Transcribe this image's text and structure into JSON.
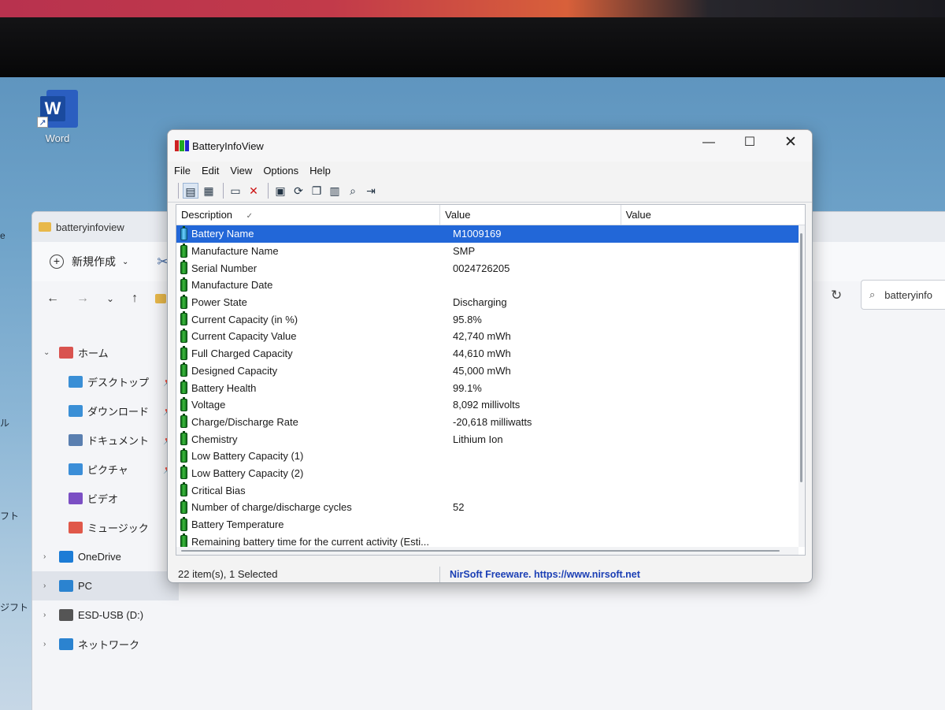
{
  "desktop": {
    "word_icon": {
      "glyph": "W",
      "label": "Word"
    },
    "left_fragments": [
      "e",
      "ル",
      "フト",
      "ジフト"
    ]
  },
  "explorer": {
    "title": "batteryinfoview",
    "new_label": "新規作成",
    "search_text": "batteryinfo",
    "nav": [
      {
        "label": "ホーム",
        "icon": "home-icon",
        "color": "#d9534f",
        "pinned": false,
        "expander": "⌄",
        "indent": false,
        "selected": false
      },
      {
        "label": "デスクトップ",
        "icon": "desktop-icon",
        "color": "#3a8fd6",
        "pinned": true,
        "expander": "",
        "indent": true,
        "selected": false
      },
      {
        "label": "ダウンロード",
        "icon": "download-icon",
        "color": "#3a8fd6",
        "pinned": true,
        "expander": "",
        "indent": true,
        "selected": false
      },
      {
        "label": "ドキュメント",
        "icon": "documents-icon",
        "color": "#5a7fb0",
        "pinned": true,
        "expander": "",
        "indent": true,
        "selected": false
      },
      {
        "label": "ピクチャ",
        "icon": "pictures-icon",
        "color": "#3b8ed8",
        "pinned": true,
        "expander": "",
        "indent": true,
        "selected": false
      },
      {
        "label": "ビデオ",
        "icon": "videos-icon",
        "color": "#7b4fc4",
        "pinned": false,
        "expander": "",
        "indent": true,
        "selected": false
      },
      {
        "label": "ミュージック",
        "icon": "music-icon",
        "color": "#e0584a",
        "pinned": false,
        "expander": "",
        "indent": true,
        "selected": false
      },
      {
        "label": "OneDrive",
        "icon": "onedrive-icon",
        "color": "#1c7cd6",
        "pinned": false,
        "expander": "›",
        "indent": false,
        "selected": false
      },
      {
        "label": "PC",
        "icon": "pc-icon",
        "color": "#2b83d0",
        "pinned": false,
        "expander": "›",
        "indent": false,
        "selected": true
      },
      {
        "label": "ESD-USB (D:)",
        "icon": "usb-drive-icon",
        "color": "#555555",
        "pinned": false,
        "expander": "›",
        "indent": false,
        "selected": false
      },
      {
        "label": "ネットワーク",
        "icon": "network-icon",
        "color": "#2b83d0",
        "pinned": false,
        "expander": "›",
        "indent": false,
        "selected": false
      }
    ]
  },
  "battery_app": {
    "title": "BatteryInfoView",
    "menu": [
      "File",
      "Edit",
      "View",
      "Options",
      "Help"
    ],
    "columns": [
      "Description",
      "Value",
      "Value"
    ],
    "sort_indicator": "✓",
    "rows": [
      {
        "desc": "Battery Name",
        "value": "M1009169",
        "selected": true
      },
      {
        "desc": "Manufacture Name",
        "value": "SMP",
        "selected": false
      },
      {
        "desc": "Serial Number",
        "value": "0024726205",
        "selected": false
      },
      {
        "desc": "Manufacture Date",
        "value": "",
        "selected": false
      },
      {
        "desc": "Power State",
        "value": "Discharging",
        "selected": false
      },
      {
        "desc": "Current Capacity (in %)",
        "value": "95.8%",
        "selected": false
      },
      {
        "desc": "Current Capacity Value",
        "value": "42,740 mWh",
        "selected": false
      },
      {
        "desc": "Full Charged Capacity",
        "value": "44,610 mWh",
        "selected": false
      },
      {
        "desc": "Designed Capacity",
        "value": "45,000 mWh",
        "selected": false
      },
      {
        "desc": "Battery Health",
        "value": "99.1%",
        "selected": false
      },
      {
        "desc": "Voltage",
        "value": "8,092 millivolts",
        "selected": false
      },
      {
        "desc": "Charge/Discharge Rate",
        "value": "-20,618 milliwatts",
        "selected": false
      },
      {
        "desc": "Chemistry",
        "value": "Lithium Ion",
        "selected": false
      },
      {
        "desc": "Low Battery Capacity (1)",
        "value": "",
        "selected": false
      },
      {
        "desc": "Low Battery Capacity (2)",
        "value": "",
        "selected": false
      },
      {
        "desc": "Critical Bias",
        "value": "",
        "selected": false
      },
      {
        "desc": "Number of charge/discharge cycles",
        "value": "52",
        "selected": false
      },
      {
        "desc": "Battery Temperature",
        "value": "",
        "selected": false
      },
      {
        "desc": "Remaining battery time for the current activity (Esti...",
        "value": "",
        "selected": false
      }
    ],
    "status_count": "22 item(s), 1 Selected",
    "status_link": "NirSoft Freeware. https://www.nirsoft.net"
  }
}
